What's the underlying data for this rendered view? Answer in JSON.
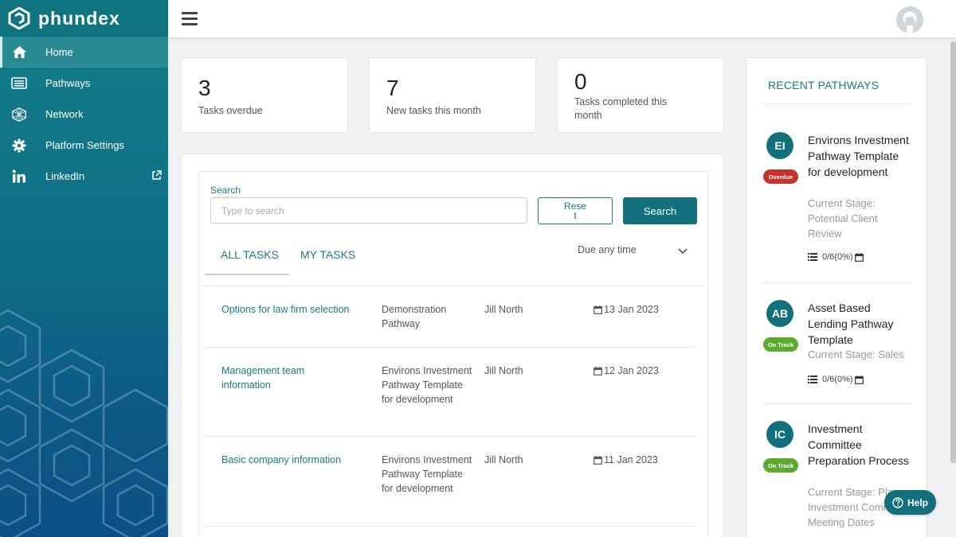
{
  "brand": {
    "name": "phundex"
  },
  "nav": [
    {
      "label": "Home",
      "icon": "home-icon"
    },
    {
      "label": "Pathways",
      "icon": "list-icon"
    },
    {
      "label": "Network",
      "icon": "network-icon"
    },
    {
      "label": "Platform Settings",
      "icon": "gear-icon"
    },
    {
      "label": "LinkedIn",
      "icon": "linkedin-icon"
    }
  ],
  "stats": [
    {
      "value": "3",
      "label": "Tasks overdue"
    },
    {
      "value": "7",
      "label": "New tasks this month"
    },
    {
      "value": "0",
      "label": "Tasks completed this month"
    }
  ],
  "search": {
    "label": "Search",
    "placeholder": "Type to search",
    "reset_label": "Reset",
    "search_label": "Search"
  },
  "tabs": {
    "all": "ALL TASKS",
    "mine": "MY TASKS"
  },
  "due_filter": "Due any time",
  "tasks": [
    {
      "name": "Options for law firm selection",
      "pathway": "Demonstration Pathway",
      "user": "Jill North",
      "date": "13 Jan 2023"
    },
    {
      "name": "Management team information",
      "pathway": "Environs Investment Pathway Template for development",
      "user": "Jill North",
      "date": "12 Jan 2023"
    },
    {
      "name": "Basic company information",
      "pathway": "Environs Investment Pathway Template for development",
      "user": "Jill North",
      "date": "11 Jan 2023"
    }
  ],
  "recent": {
    "title": "RECENT PATHWAYS",
    "items": [
      {
        "initials": "EI",
        "badge": "Overdue",
        "title": "Environs Investment Pathway Template for development",
        "stage": "Current Stage: Potential Client Review",
        "progress": "0/6(0%)"
      },
      {
        "initials": "AB",
        "badge": "On Track",
        "title": "Asset Based Lending Pathway Template",
        "stage": "Current Stage: Sales",
        "progress": "0/6(0%)"
      },
      {
        "initials": "IC",
        "badge": "On Track",
        "title": "Investment Committee Preparation Process",
        "stage": "Current Stage: Plan Investment Committee Meeting Dates",
        "progress": ""
      }
    ]
  },
  "help": {
    "label": "Help"
  },
  "colors": {
    "teal": "#12707c",
    "overdue": "#c8322c",
    "ontrack": "#5caa2d"
  }
}
